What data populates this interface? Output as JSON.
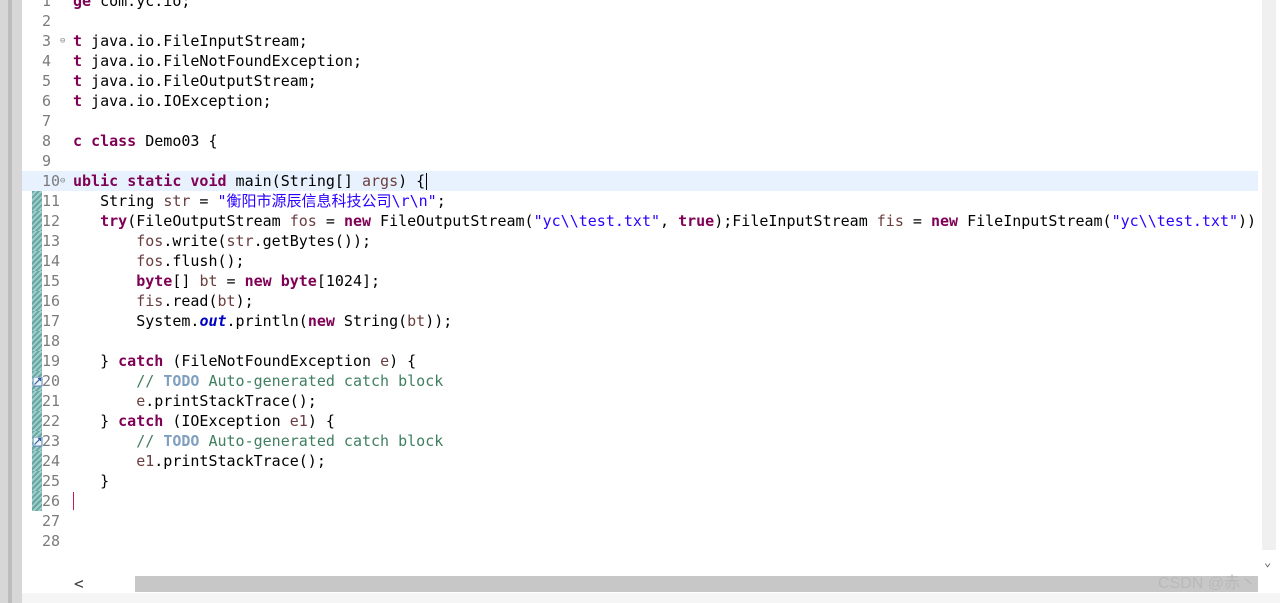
{
  "editor": {
    "lines": [
      {
        "n": "1",
        "tokens": [
          {
            "t": "ge",
            "c": "kw"
          },
          {
            "t": " com.yc.io;"
          }
        ]
      },
      {
        "n": "2",
        "tokens": []
      },
      {
        "n": "3",
        "fold": "⊖",
        "tokens": [
          {
            "t": "t",
            "c": "kw"
          },
          {
            "t": " java.io.FileInputStream;"
          }
        ]
      },
      {
        "n": "4",
        "tokens": [
          {
            "t": "t",
            "c": "kw"
          },
          {
            "t": " java.io.FileNotFoundException;"
          }
        ]
      },
      {
        "n": "5",
        "tokens": [
          {
            "t": "t",
            "c": "kw"
          },
          {
            "t": " java.io.FileOutputStream;"
          }
        ]
      },
      {
        "n": "6",
        "tokens": [
          {
            "t": "t",
            "c": "kw"
          },
          {
            "t": " java.io.IOException;"
          }
        ]
      },
      {
        "n": "7",
        "tokens": []
      },
      {
        "n": "8",
        "tokens": [
          {
            "t": "c",
            "c": "kw"
          },
          {
            "t": " "
          },
          {
            "t": "class",
            "c": "kw"
          },
          {
            "t": " Demo03 {"
          }
        ]
      },
      {
        "n": "9",
        "tokens": []
      },
      {
        "n": "10",
        "fold": "⊖",
        "current": true,
        "caret": true,
        "tokens": [
          {
            "t": "ublic",
            "c": "kw"
          },
          {
            "t": " "
          },
          {
            "t": "static",
            "c": "kw"
          },
          {
            "t": " "
          },
          {
            "t": "void",
            "c": "kw"
          },
          {
            "t": " main(String[] "
          },
          {
            "t": "args",
            "c": "vr"
          },
          {
            "t": ") {"
          }
        ]
      },
      {
        "n": "11",
        "tokens": [
          {
            "t": "   String "
          },
          {
            "t": "str",
            "c": "vr"
          },
          {
            "t": " = "
          },
          {
            "t": "\"衡阳市源辰信息科技公司\\r\\n\"",
            "c": "st"
          },
          {
            "t": ";"
          }
        ]
      },
      {
        "n": "12",
        "tokens": [
          {
            "t": "   "
          },
          {
            "t": "try",
            "c": "kw"
          },
          {
            "t": "(FileOutputStream "
          },
          {
            "t": "fos",
            "c": "vr"
          },
          {
            "t": " = "
          },
          {
            "t": "new",
            "c": "kw"
          },
          {
            "t": " FileOutputStream("
          },
          {
            "t": "\"yc\\\\test.txt\"",
            "c": "st"
          },
          {
            "t": ", "
          },
          {
            "t": "true",
            "c": "kw"
          },
          {
            "t": ");FileInputStream "
          },
          {
            "t": "fis",
            "c": "vr"
          },
          {
            "t": " = "
          },
          {
            "t": "new",
            "c": "kw"
          },
          {
            "t": " FileInputStream("
          },
          {
            "t": "\"yc\\\\test.txt\"",
            "c": "st"
          },
          {
            "t": "))"
          }
        ]
      },
      {
        "n": "13",
        "tokens": [
          {
            "t": "       "
          },
          {
            "t": "fos",
            "c": "vr"
          },
          {
            "t": ".write("
          },
          {
            "t": "str",
            "c": "vr"
          },
          {
            "t": ".getBytes());"
          }
        ]
      },
      {
        "n": "14",
        "tokens": [
          {
            "t": "       "
          },
          {
            "t": "fos",
            "c": "vr"
          },
          {
            "t": ".flush();"
          }
        ]
      },
      {
        "n": "15",
        "tokens": [
          {
            "t": "       "
          },
          {
            "t": "byte",
            "c": "kw"
          },
          {
            "t": "[] "
          },
          {
            "t": "bt",
            "c": "vr"
          },
          {
            "t": " = "
          },
          {
            "t": "new",
            "c": "kw"
          },
          {
            "t": " "
          },
          {
            "t": "byte",
            "c": "kw"
          },
          {
            "t": "[1024];"
          }
        ]
      },
      {
        "n": "16",
        "tokens": [
          {
            "t": "       "
          },
          {
            "t": "fis",
            "c": "vr"
          },
          {
            "t": ".read("
          },
          {
            "t": "bt",
            "c": "vr"
          },
          {
            "t": ");"
          }
        ]
      },
      {
        "n": "17",
        "tokens": [
          {
            "t": "       System."
          },
          {
            "t": "out",
            "c": "fd"
          },
          {
            "t": ".println("
          },
          {
            "t": "new",
            "c": "kw"
          },
          {
            "t": " String("
          },
          {
            "t": "bt",
            "c": "vr"
          },
          {
            "t": "));"
          }
        ]
      },
      {
        "n": "18",
        "tokens": []
      },
      {
        "n": "19",
        "tokens": [
          {
            "t": "   } "
          },
          {
            "t": "catch",
            "c": "kw"
          },
          {
            "t": " (FileNotFoundException "
          },
          {
            "t": "e",
            "c": "vr"
          },
          {
            "t": ") {"
          }
        ]
      },
      {
        "n": "20",
        "tokens": [
          {
            "t": "       "
          },
          {
            "t": "// ",
            "c": "cm"
          },
          {
            "t": "TODO",
            "c": "td"
          },
          {
            "t": " Auto-generated catch block",
            "c": "cm"
          }
        ]
      },
      {
        "n": "21",
        "tokens": [
          {
            "t": "       "
          },
          {
            "t": "e",
            "c": "vr"
          },
          {
            "t": ".printStackTrace();"
          }
        ]
      },
      {
        "n": "22",
        "tokens": [
          {
            "t": "   } "
          },
          {
            "t": "catch",
            "c": "kw"
          },
          {
            "t": " (IOException "
          },
          {
            "t": "e1",
            "c": "vr"
          },
          {
            "t": ") {"
          }
        ]
      },
      {
        "n": "23",
        "tokens": [
          {
            "t": "       "
          },
          {
            "t": "// ",
            "c": "cm"
          },
          {
            "t": "TODO",
            "c": "td"
          },
          {
            "t": " Auto-generated catch block",
            "c": "cm"
          }
        ]
      },
      {
        "n": "24",
        "tokens": [
          {
            "t": "       "
          },
          {
            "t": "e1",
            "c": "vr"
          },
          {
            "t": ".printStackTrace();"
          }
        ]
      },
      {
        "n": "25",
        "tokens": [
          {
            "t": "   }"
          }
        ]
      },
      {
        "n": "26",
        "caret2": true,
        "tokens": []
      },
      {
        "n": "27",
        "tokens": []
      },
      {
        "n": "28",
        "tokens": []
      }
    ],
    "changed_lines": [
      "10",
      "11",
      "12",
      "13",
      "14",
      "15",
      "16",
      "17",
      "18",
      "19",
      "20",
      "21",
      "22",
      "23",
      "24",
      "25",
      "26"
    ],
    "warning_lines": [
      "20",
      "23"
    ]
  },
  "scrollbars": {
    "left_arrow": "<",
    "down_arrow": "⌄"
  },
  "watermark": "CSDN @赤丶"
}
